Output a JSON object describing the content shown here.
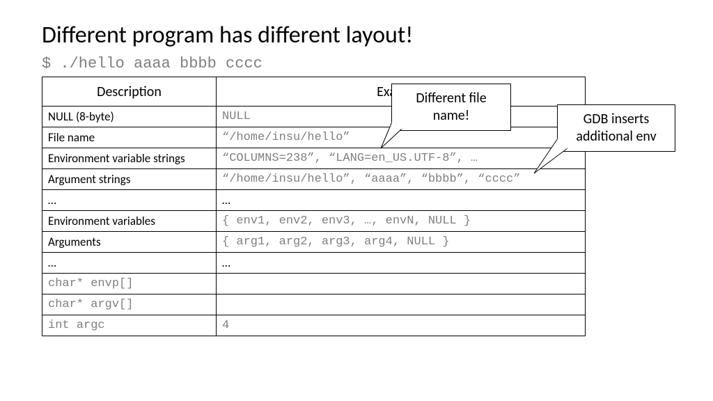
{
  "title": "Different program has different layout!",
  "command": "$ ./hello aaaa bbbb cccc",
  "table": {
    "headers": {
      "desc": "Description",
      "ex": "Example"
    },
    "rows": [
      {
        "desc": "NULL (8-byte)",
        "desc_mono": false,
        "ex": "NULL",
        "ex_mono": true
      },
      {
        "desc": "File name",
        "desc_mono": false,
        "ex": "“/home/insu/hello”",
        "ex_mono": true
      },
      {
        "desc": "Environment variable strings",
        "desc_mono": false,
        "ex": "“COLUMNS=238”, “LANG=en_US.UTF-8”, …",
        "ex_mono": true
      },
      {
        "desc": "Argument strings",
        "desc_mono": false,
        "ex": "“/home/insu/hello”, “aaaa”, “bbbb”, “cccc”",
        "ex_mono": true
      },
      {
        "desc": "…",
        "desc_mono": false,
        "ex": "…",
        "ex_mono": false
      },
      {
        "desc": "Environment variables",
        "desc_mono": false,
        "ex": "{ env1, env2, env3, …, envN, NULL }",
        "ex_mono": true
      },
      {
        "desc": "Arguments",
        "desc_mono": false,
        "ex": "{ arg1, arg2, arg3, arg4, NULL }",
        "ex_mono": true
      },
      {
        "desc": "…",
        "desc_mono": false,
        "ex": "…",
        "ex_mono": false
      },
      {
        "desc": "char* envp[]",
        "desc_mono": true,
        "ex": "",
        "ex_mono": false
      },
      {
        "desc": "char* argv[]",
        "desc_mono": true,
        "ex": "",
        "ex_mono": false
      },
      {
        "desc": "int argc",
        "desc_mono": true,
        "ex": "4",
        "ex_mono": true
      }
    ]
  },
  "callouts": {
    "filename": "Different file name!",
    "gdb": "GDB inserts additional env"
  }
}
